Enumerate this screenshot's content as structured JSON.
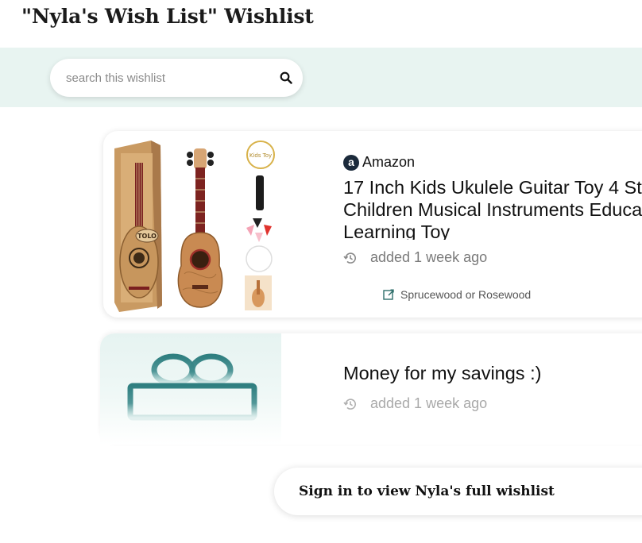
{
  "header": {
    "title": "\"Nyla's Wish List\" Wishlist"
  },
  "search": {
    "placeholder": "search this wishlist",
    "value": ""
  },
  "items": [
    {
      "store": "Amazon",
      "store_icon_letter": "a",
      "title_line1": "17 Inch Kids Ukulele Guitar Toy 4 St",
      "title_line2": "Children Musical Instruments Educa",
      "title_line3": "Learning Toy",
      "added": "added 1 week ago",
      "note": "Sprucewood or Rosewood",
      "image_label": "TOLO",
      "image_badge": "Kids Toy"
    },
    {
      "title": "Money for my savings :)",
      "added": "added 1 week ago"
    }
  ],
  "footer": {
    "signin_label": "Sign in to view Nyla's full wishlist"
  },
  "colors": {
    "band": "#e8f4f1",
    "gift_teal": "#3f8c8d",
    "store_icon_bg": "#1b2a3b"
  }
}
